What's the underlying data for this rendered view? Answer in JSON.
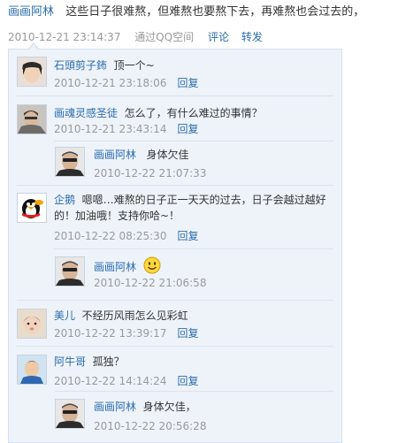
{
  "post": {
    "author": "画画阿林",
    "text": "这些日子很难熬，但难熬也要熬下去，再难熬也会过去的，",
    "timestamp": "2010-12-21 23:14:37",
    "source": "通过QQ空间",
    "comment_label": "评论",
    "forward_label": "转发"
  },
  "comments": [
    {
      "author": "石頭剪子鈽",
      "text": "顶一个~",
      "timestamp": "2010-12-21 23:18:06",
      "reply_label": "回复"
    },
    {
      "author": "画魂灵感圣徒",
      "text": "怎么了，有什么难过的事情？",
      "timestamp": "2010-12-21 23:43:14",
      "reply_label": "回复"
    },
    {
      "author": "画画阿林",
      "text": "身体欠佳",
      "timestamp": "2010-12-22 21:07:33",
      "reply_label": ""
    },
    {
      "author": "企鹅",
      "text_line1": "嗯嗯…难熬的日子正一天天的过去，日子会越过越好",
      "text_line2": "的！加油哦！支持你哈~！",
      "timestamp": "2010-12-22 08:25:30",
      "reply_label": "回复"
    },
    {
      "author": "画画阿林",
      "text": "",
      "emoji": "smile-emoji",
      "timestamp": "2010-12-22 21:06:58",
      "reply_label": ""
    },
    {
      "author": "美儿",
      "text": "不经历风雨怎么见彩虹",
      "timestamp": "2010-12-22 13:39:17",
      "reply_label": "回复"
    },
    {
      "author": "阿牛哥",
      "text": "孤独？",
      "timestamp": "2010-12-22 14:14:24",
      "reply_label": "回复"
    },
    {
      "author": "画画阿林",
      "text": "身体欠佳，",
      "timestamp": "2010-12-22 20:56:28",
      "reply_label": ""
    }
  ],
  "colors": {
    "link": "#2b6dad",
    "meta": "#999999",
    "panel": "#eef3fa",
    "border": "#d5e1ef"
  }
}
